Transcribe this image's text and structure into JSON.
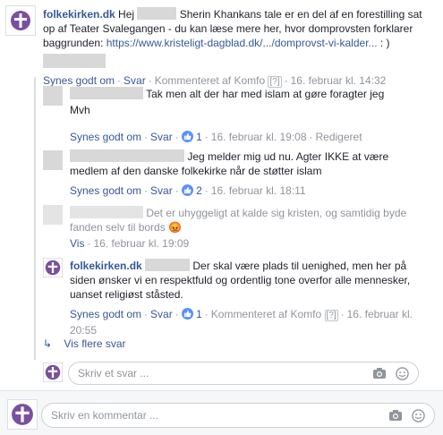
{
  "main_comment": {
    "author": "folkekirken.dk",
    "text_part1": "Hej",
    "text_part2": "Sherin Khankans tale er en del af en forestilling sat op af Teater Svalegangen - du kan læse mere her, hvor domprovsten forklarer baggrunden:",
    "link": "https://www.kristeligt-dagblad.dk/.../domprovst-vi-kalder...",
    "text_part3": ": )",
    "like": "Synes godt om",
    "reply": "Svar",
    "commented_by": "Kommenteret af Komfo",
    "qmark": "[?]",
    "date": "16. februar kl. 14:32"
  },
  "replies": [
    {
      "text": "Tak men alt der har med islam at gøre foragter jeg",
      "text2": "Mvh",
      "like": "Synes godt om",
      "reply": "Svar",
      "likes": "1",
      "date": "16. februar kl. 19:08",
      "edited": "Redigeret"
    },
    {
      "text": "Jeg melder mig ud nu. Agter IKKE at være medlem af den danske folkekirke når de støtter islam",
      "like": "Synes godt om",
      "reply": "Svar",
      "likes": "2",
      "date": "16. februar kl. 18:11"
    },
    {
      "text": "Det er uhyggeligt at kalde sig kristen, og samtidig byde fanden selv til bords",
      "emoji": "😡",
      "show": "Vis",
      "date": "16. februar kl. 19:09"
    },
    {
      "author": "folkekirken.dk",
      "text": "Der skal være plads til uenighed, men her på siden ønsker vi en respektfuld og ordentlig tone overfor alle mennesker, uanset religiøst ståsted.",
      "like": "Synes godt om",
      "reply": "Svar",
      "likes": "1",
      "commented_by": "Kommenteret af Komfo",
      "qmark": "[?]",
      "date": "16. februar kl. 20:55"
    }
  ],
  "more_replies": "Vis flere svar",
  "reply_input": {
    "placeholder": "Skriv et svar ..."
  },
  "comment_input": {
    "placeholder": "Skriv en kommentar ..."
  },
  "colors": {
    "link": "#365899",
    "brand": "#7b4fa0",
    "like": "#5890ff"
  },
  "icons": [
    "cross-logo-icon",
    "thumbs-up-icon",
    "camera-icon",
    "smiley-icon",
    "reply-arrow-icon"
  ]
}
